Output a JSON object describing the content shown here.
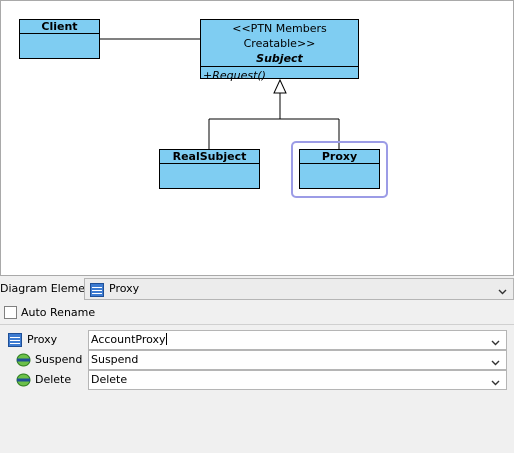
{
  "diagram": {
    "client": {
      "name": "Client"
    },
    "subject": {
      "stereotype": "<<PTN Members Creatable>>",
      "name": "Subject",
      "operation": "+Request()"
    },
    "real_subject": {
      "name": "RealSubject"
    },
    "proxy": {
      "name": "Proxy"
    }
  },
  "panel": {
    "diagram_element_label": "Diagram Element",
    "diagram_element_value": "Proxy",
    "auto_rename_label": "Auto Rename",
    "auto_rename_checked": false,
    "properties": [
      {
        "icon": "class-icon",
        "label": "Proxy",
        "value": "AccountProxy"
      },
      {
        "icon": "operation-icon",
        "label": "Suspend",
        "value": "Suspend"
      },
      {
        "icon": "operation-icon",
        "label": "Delete",
        "value": "Delete"
      }
    ]
  },
  "colors": {
    "class_fill": "#7fcdf2",
    "selection": "#9c9ce6"
  }
}
